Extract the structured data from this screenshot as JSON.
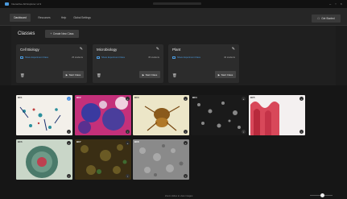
{
  "app": {
    "title": "Interactive AR Explorer v2.3"
  },
  "nav": {
    "tabs": [
      {
        "label": "Dashboard"
      },
      {
        "label": "Resources"
      },
      {
        "label": "Help"
      },
      {
        "label": "Global Settings"
      }
    ],
    "help_button": "Get Started"
  },
  "classes": {
    "title": "Classes",
    "create_button": "Create New Class",
    "cards": [
      {
        "title": "Cell Biology",
        "link": "Share Experiment Class",
        "count": "25 students",
        "start": "Start Class"
      },
      {
        "title": "Microbiology",
        "link": "Share Experiment Class",
        "count": "35 students",
        "start": "Start Class"
      },
      {
        "title": "Plant",
        "link": "Share Experiment Class",
        "count": "40 students",
        "start": "Start Class"
      }
    ]
  },
  "images": {
    "items": [
      {
        "label": "BC1"
      },
      {
        "label": "BC2"
      },
      {
        "label": "BC3"
      },
      {
        "label": "BC4"
      },
      {
        "label": "BC5"
      },
      {
        "label": "BC6"
      },
      {
        "label": "BC7"
      },
      {
        "label": "BC8"
      }
    ]
  },
  "footer": {
    "text": "Zoom slides to view images"
  },
  "colors": {
    "accent": "#4a9ade",
    "background": "#1c1c1c",
    "card": "#2c2c2c"
  }
}
